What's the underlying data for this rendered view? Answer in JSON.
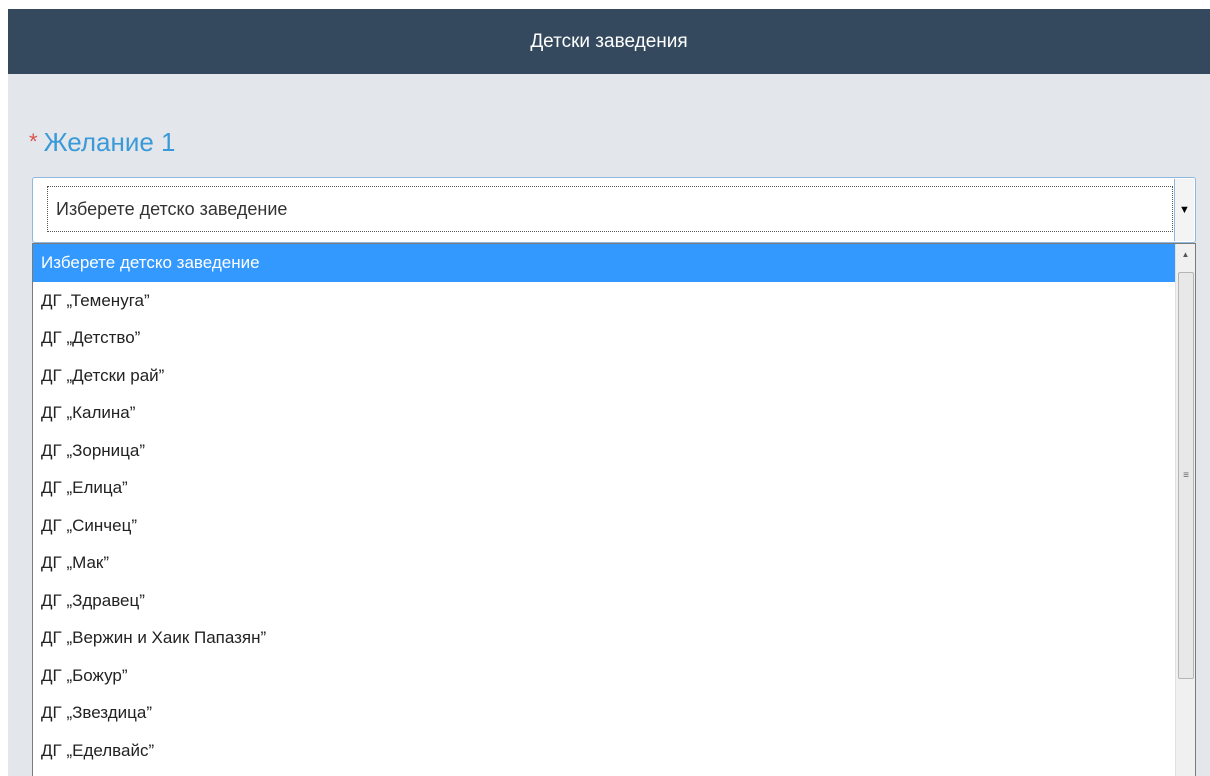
{
  "header": {
    "title": "Детски заведения"
  },
  "wish": {
    "required_mark": "*",
    "label": "Желание 1"
  },
  "select": {
    "value": "Изберете детско заведение",
    "arrow_icon": "▼"
  },
  "dropdown": {
    "options": [
      "Изберете детско заведение",
      "ДГ „Теменуга”",
      "ДГ „Детство”",
      "ДГ „Детски рай”",
      "ДГ „Калина”",
      "ДГ „Зорница”",
      "ДГ „Елица”",
      "ДГ „Синчец”",
      "ДГ „Мак”",
      "ДГ „Здравец”",
      "ДГ „Вержин и Хаик Папазян”",
      "ДГ „Божур”",
      "ДГ „Звездица”",
      "ДГ „Еделвайс”"
    ],
    "selected_index": 0,
    "scroll_up_icon": "▲",
    "scroll_grip_icon": "≡"
  },
  "colors": {
    "header_bg": "#34495e",
    "label_color": "#3a9ad9",
    "required_color": "#d9534f",
    "selected_bg": "#3399ff"
  }
}
